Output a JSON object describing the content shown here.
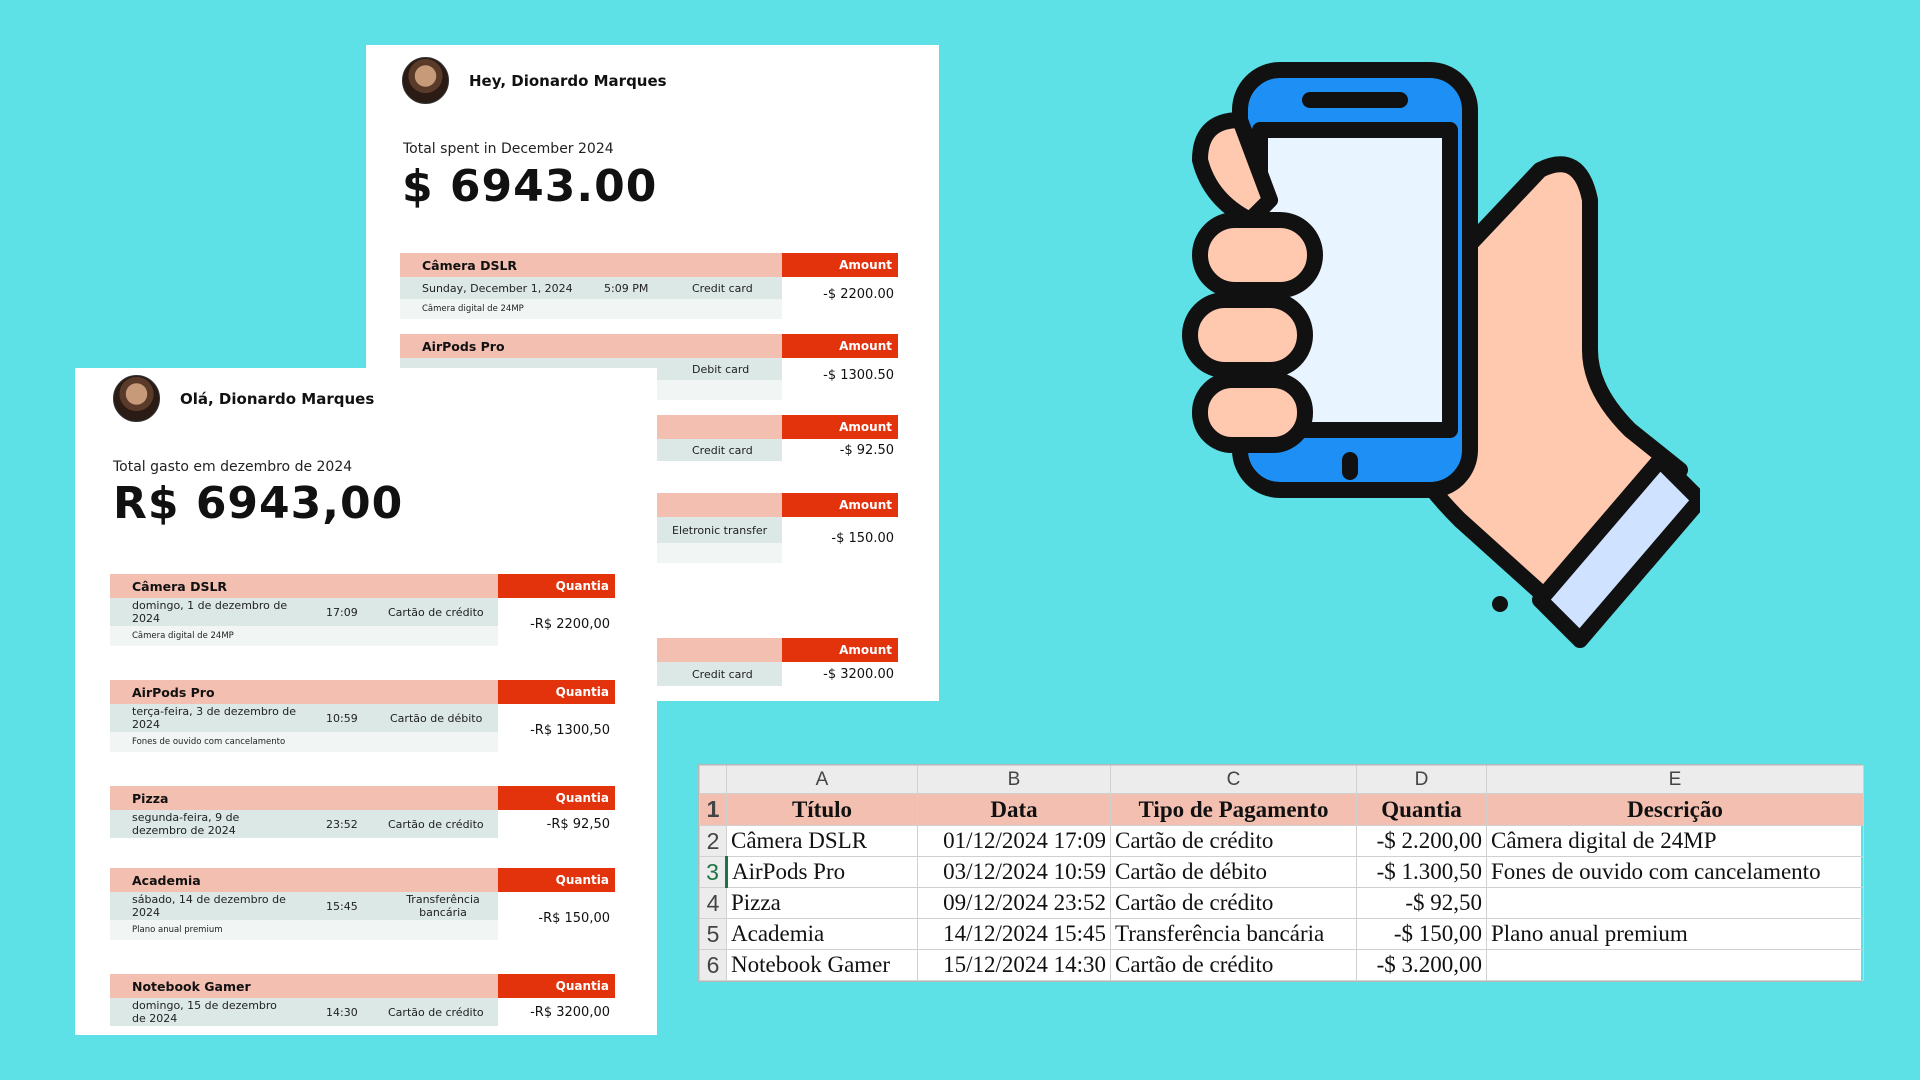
{
  "en_summary": {
    "greeting": "Hey, Dionardo Marques",
    "total_label": "Total spent in December 2024",
    "total_value": "$ 6943.00",
    "amount_label": "Amount",
    "transactions": [
      {
        "title": "Câmera DSLR",
        "date": "Sunday, December 1, 2024",
        "time": "5:09 PM",
        "method": "Credit card",
        "description": "Câmera digital de 24MP",
        "amount": "-$ 2200.00"
      },
      {
        "title": "AirPods Pro",
        "method": "Debit card",
        "amount": "-$ 1300.50"
      },
      {
        "method": "Credit card",
        "amount": "-$ 92.50"
      },
      {
        "method": "Eletronic transfer",
        "amount": "-$ 150.00"
      },
      {
        "method": "Credit card",
        "amount": "-$ 3200.00"
      }
    ]
  },
  "pt_summary": {
    "greeting": "Olá, Dionardo Marques",
    "total_label": "Total gasto em dezembro de 2024",
    "total_value": "R$ 6943,00",
    "amount_label": "Quantia",
    "transactions": [
      {
        "title": "Câmera DSLR",
        "date": "domingo, 1 de dezembro de 2024",
        "time": "17:09",
        "method": "Cartão de crédito",
        "description": "Câmera digital de 24MP",
        "amount": "-R$ 2200,00"
      },
      {
        "title": "AirPods Pro",
        "date": "terça-feira, 3 de dezembro de 2024",
        "time": "10:59",
        "method": "Cartão de débito",
        "description": "Fones de ouvido com cancelamento",
        "amount": "-R$ 1300,50"
      },
      {
        "title": "Pizza",
        "date": "segunda-feira, 9 de dezembro de 2024",
        "time": "23:52",
        "method": "Cartão de crédito",
        "amount": "-R$ 92,50"
      },
      {
        "title": "Academia",
        "date": "sábado, 14 de dezembro de 2024",
        "time": "15:45",
        "method": "Transferência bancária",
        "description": "Plano anual premium",
        "amount": "-R$ 150,00"
      },
      {
        "title": "Notebook Gamer",
        "date": "domingo, 15 de dezembro de 2024",
        "time": "14:30",
        "method": "Cartão de crédito",
        "amount": "-R$ 3200,00"
      }
    ]
  },
  "spreadsheet": {
    "columns": [
      "A",
      "B",
      "C",
      "D",
      "E"
    ],
    "rows": [
      "1",
      "2",
      "3",
      "4",
      "5",
      "6"
    ],
    "headers": [
      "Título",
      "Data",
      "Tipo de Pagamento",
      "Quantia",
      "Descrição"
    ],
    "data": [
      [
        "Câmera DSLR",
        "01/12/2024 17:09",
        "Cartão de crédito",
        "-$ 2.200,00",
        "Câmera digital de 24MP"
      ],
      [
        "AirPods Pro",
        "03/12/2024 10:59",
        "Cartão de débito",
        "-$ 1.300,50",
        "Fones de ouvido com cancelamento"
      ],
      [
        "Pizza",
        "09/12/2024 23:52",
        "Cartão de crédito",
        "-$ 92,50",
        ""
      ],
      [
        "Academia",
        "14/12/2024 15:45",
        "Transferência bancária",
        "-$ 150,00",
        "Plano anual premium"
      ],
      [
        "Notebook Gamer",
        "15/12/2024 14:30",
        "Cartão de crédito",
        "-$ 3.200,00",
        ""
      ]
    ]
  },
  "icons": {
    "illustration": "hand-holding-phone-icon",
    "avatar": "user-avatar"
  },
  "colors": {
    "background": "#5de1e6",
    "accent": "#e2330d",
    "header_pink": "#f3bfb1",
    "meta_bg": "#dbe8e6"
  }
}
